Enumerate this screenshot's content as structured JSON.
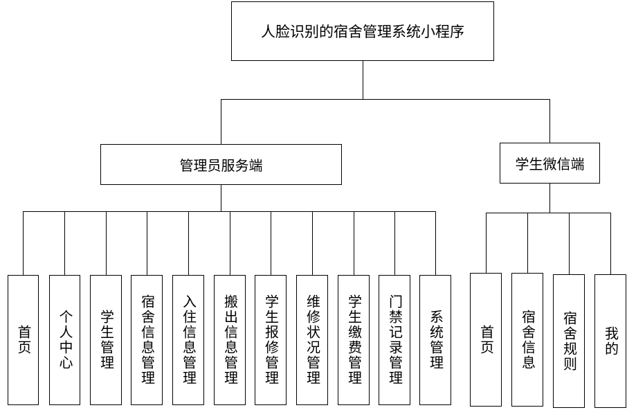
{
  "root": {
    "label": "人脸识别的宿舍管理系统小程序"
  },
  "branches": [
    {
      "label": "管理员服务端",
      "children": [
        "首页",
        "个人中心",
        "学生管理",
        "宿舍信息管理",
        "入住信息管理",
        "搬出信息管理",
        "学生报修管理",
        "维修状况管理",
        "学生缴费管理",
        "门禁记录管理",
        "系统管理"
      ]
    },
    {
      "label": "学生微信端",
      "children": [
        "首页",
        "宿舍信息",
        "宿舍规则",
        "我的"
      ]
    }
  ],
  "colors": {
    "line": "#000000",
    "box_border": "#000000",
    "background": "#ffffff",
    "text": "#000000"
  }
}
